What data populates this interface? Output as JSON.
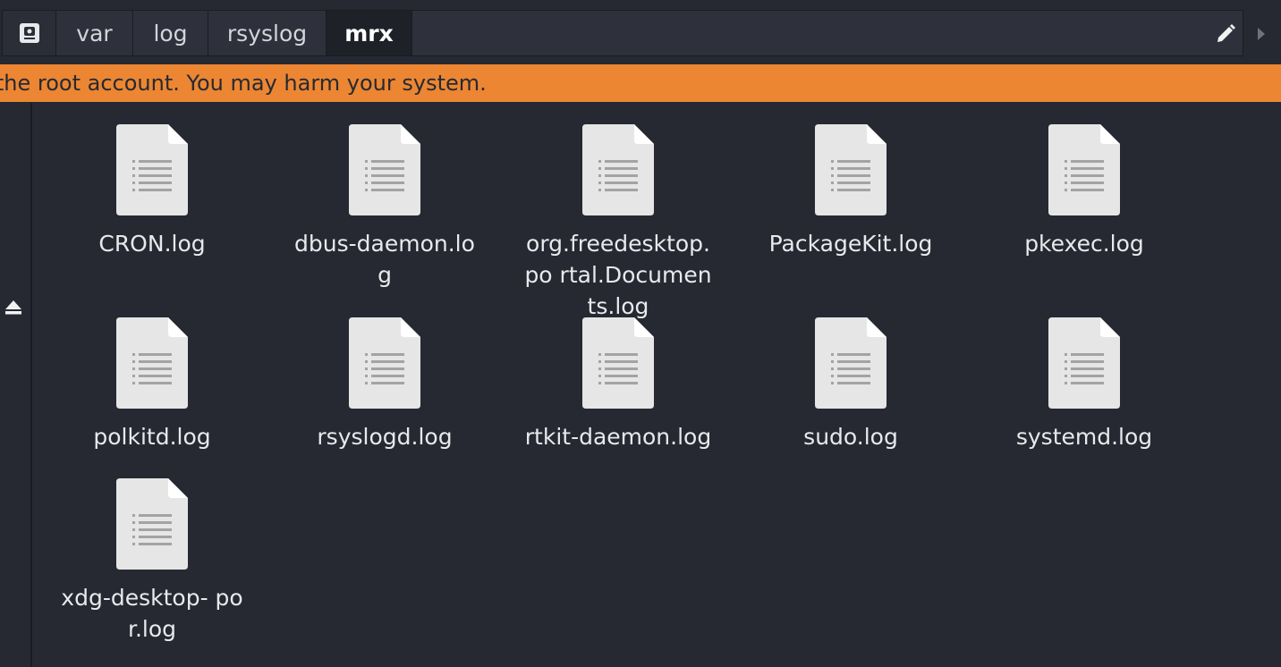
{
  "pathbar": {
    "crumbs": [
      "var",
      "log",
      "rsyslog",
      "mrx"
    ],
    "root_icon": "drive-icon",
    "edit_icon": "pencil-icon",
    "next_icon": "triangle-right-icon"
  },
  "warning": {
    "text": "g the root account. You may harm your system.",
    "color": "#ec8632"
  },
  "sidebar": {
    "eject_icon": "eject-icon"
  },
  "files": [
    {
      "name": "CRON.log"
    },
    {
      "name": "dbus-daemon.log"
    },
    {
      "name": "org.freedesktop.po rtal.Documents.log"
    },
    {
      "name": "PackageKit.log"
    },
    {
      "name": "pkexec.log"
    },
    {
      "name": "polkitd.log"
    },
    {
      "name": "rsyslogd.log"
    },
    {
      "name": "rtkit-daemon.log"
    },
    {
      "name": "sudo.log"
    },
    {
      "name": "systemd.log"
    },
    {
      "name": "xdg-desktop- por.log"
    }
  ]
}
